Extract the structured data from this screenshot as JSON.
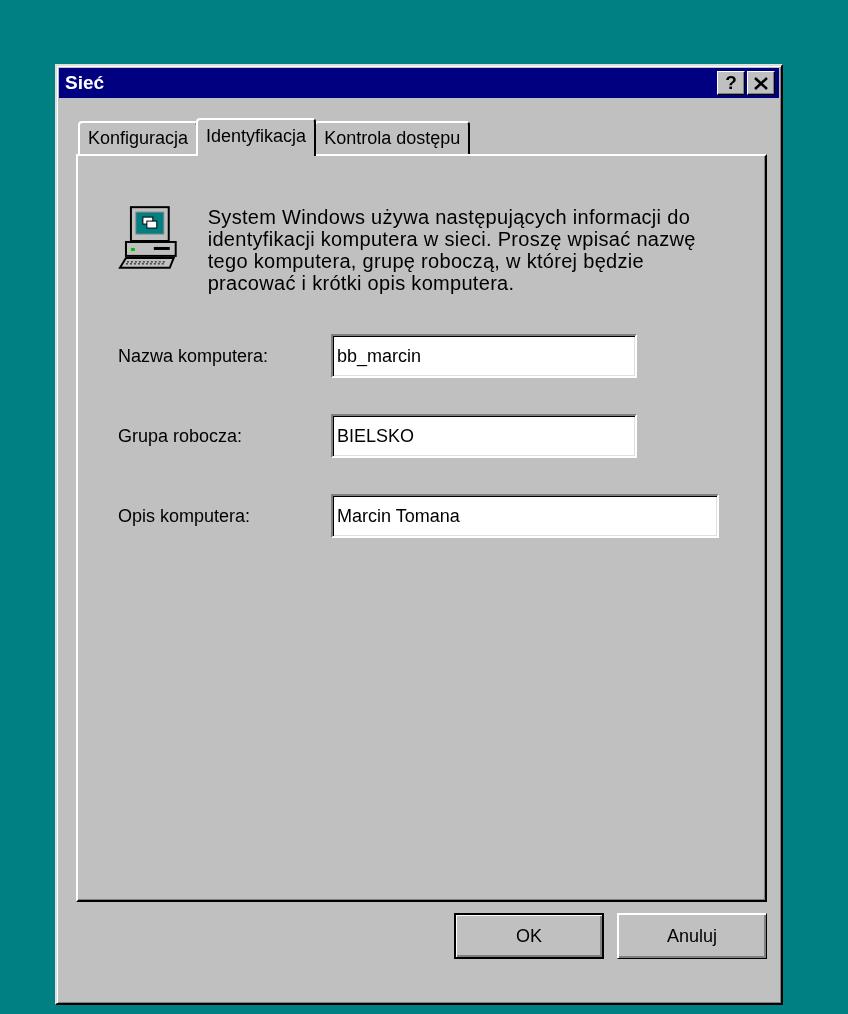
{
  "window": {
    "title": "Sieć",
    "help_button": "?"
  },
  "tabs": [
    {
      "label": "Konfiguracja",
      "selected": false
    },
    {
      "label": "Identyfikacja",
      "selected": true
    },
    {
      "label": "Kontrola dostępu",
      "selected": false
    }
  ],
  "description": "System Windows używa następujących informacji do identyfikacji komputera w sieci. Proszę wpisać nazwę tego komputera, grupę roboczą, w której będzie pracować i krótki opis komputera.",
  "fields": [
    {
      "label": "Nazwa komputera:",
      "value": "bb_marcin",
      "wide": false
    },
    {
      "label": "Grupa robocza:",
      "value": "BIELSKO",
      "wide": false
    },
    {
      "label": "Opis komputera:",
      "value": "Marcin Tomana",
      "wide": true
    }
  ],
  "buttons": [
    {
      "label": "OK",
      "default": true
    },
    {
      "label": "Anuluj",
      "default": false
    }
  ]
}
